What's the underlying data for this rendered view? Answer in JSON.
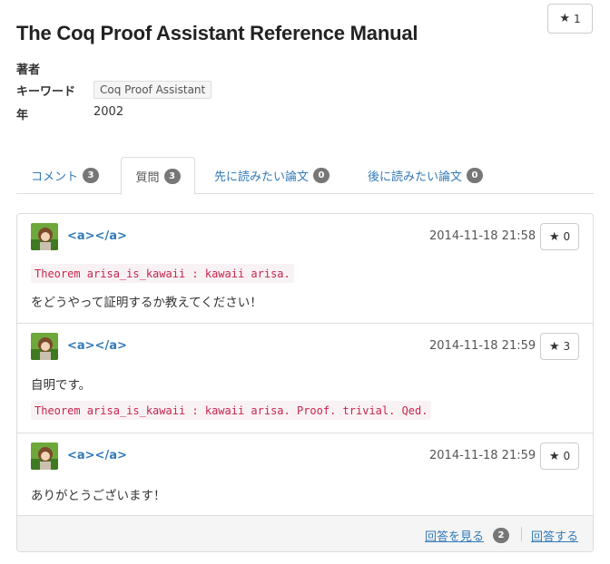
{
  "paper": {
    "title": "The Coq Proof Assistant Reference Manual",
    "star_count": "1",
    "author_label": "著者",
    "keyword_label": "キーワード",
    "keyword_tag": "Coq Proof Assistant",
    "year_label": "年",
    "year_value": "2002"
  },
  "tabs": [
    {
      "label": "コメント",
      "count": "3"
    },
    {
      "label": "質問",
      "count": "3"
    },
    {
      "label": "先に読みたい論文",
      "count": "0"
    },
    {
      "label": "後に読みたい論文",
      "count": "0"
    }
  ],
  "posts": [
    {
      "user": "<a></a>",
      "time": "2014-11-18 21:58",
      "stars": "0",
      "code": "Theorem arisa_is_kawaii : kawaii arisa.",
      "text": "をどうやって証明するか教えてください！"
    },
    {
      "user": "<a></a>",
      "time": "2014-11-18 21:59",
      "stars": "3",
      "text": "自明です。",
      "code": "Theorem arisa_is_kawaii : kawaii arisa. Proof. trivial. Qed."
    },
    {
      "user": "<a></a>",
      "time": "2014-11-18 21:59",
      "stars": "0",
      "text": "ありがとうございます！"
    }
  ],
  "footer": {
    "view_answers": "回答を見る",
    "answer_count": "2",
    "answer": "回答する"
  },
  "icons": {
    "star": "star-icon"
  },
  "colors": {
    "link": "#337ab7",
    "code_text": "#c7254e",
    "code_bg": "#f9f2f4",
    "badge": "#777777"
  }
}
